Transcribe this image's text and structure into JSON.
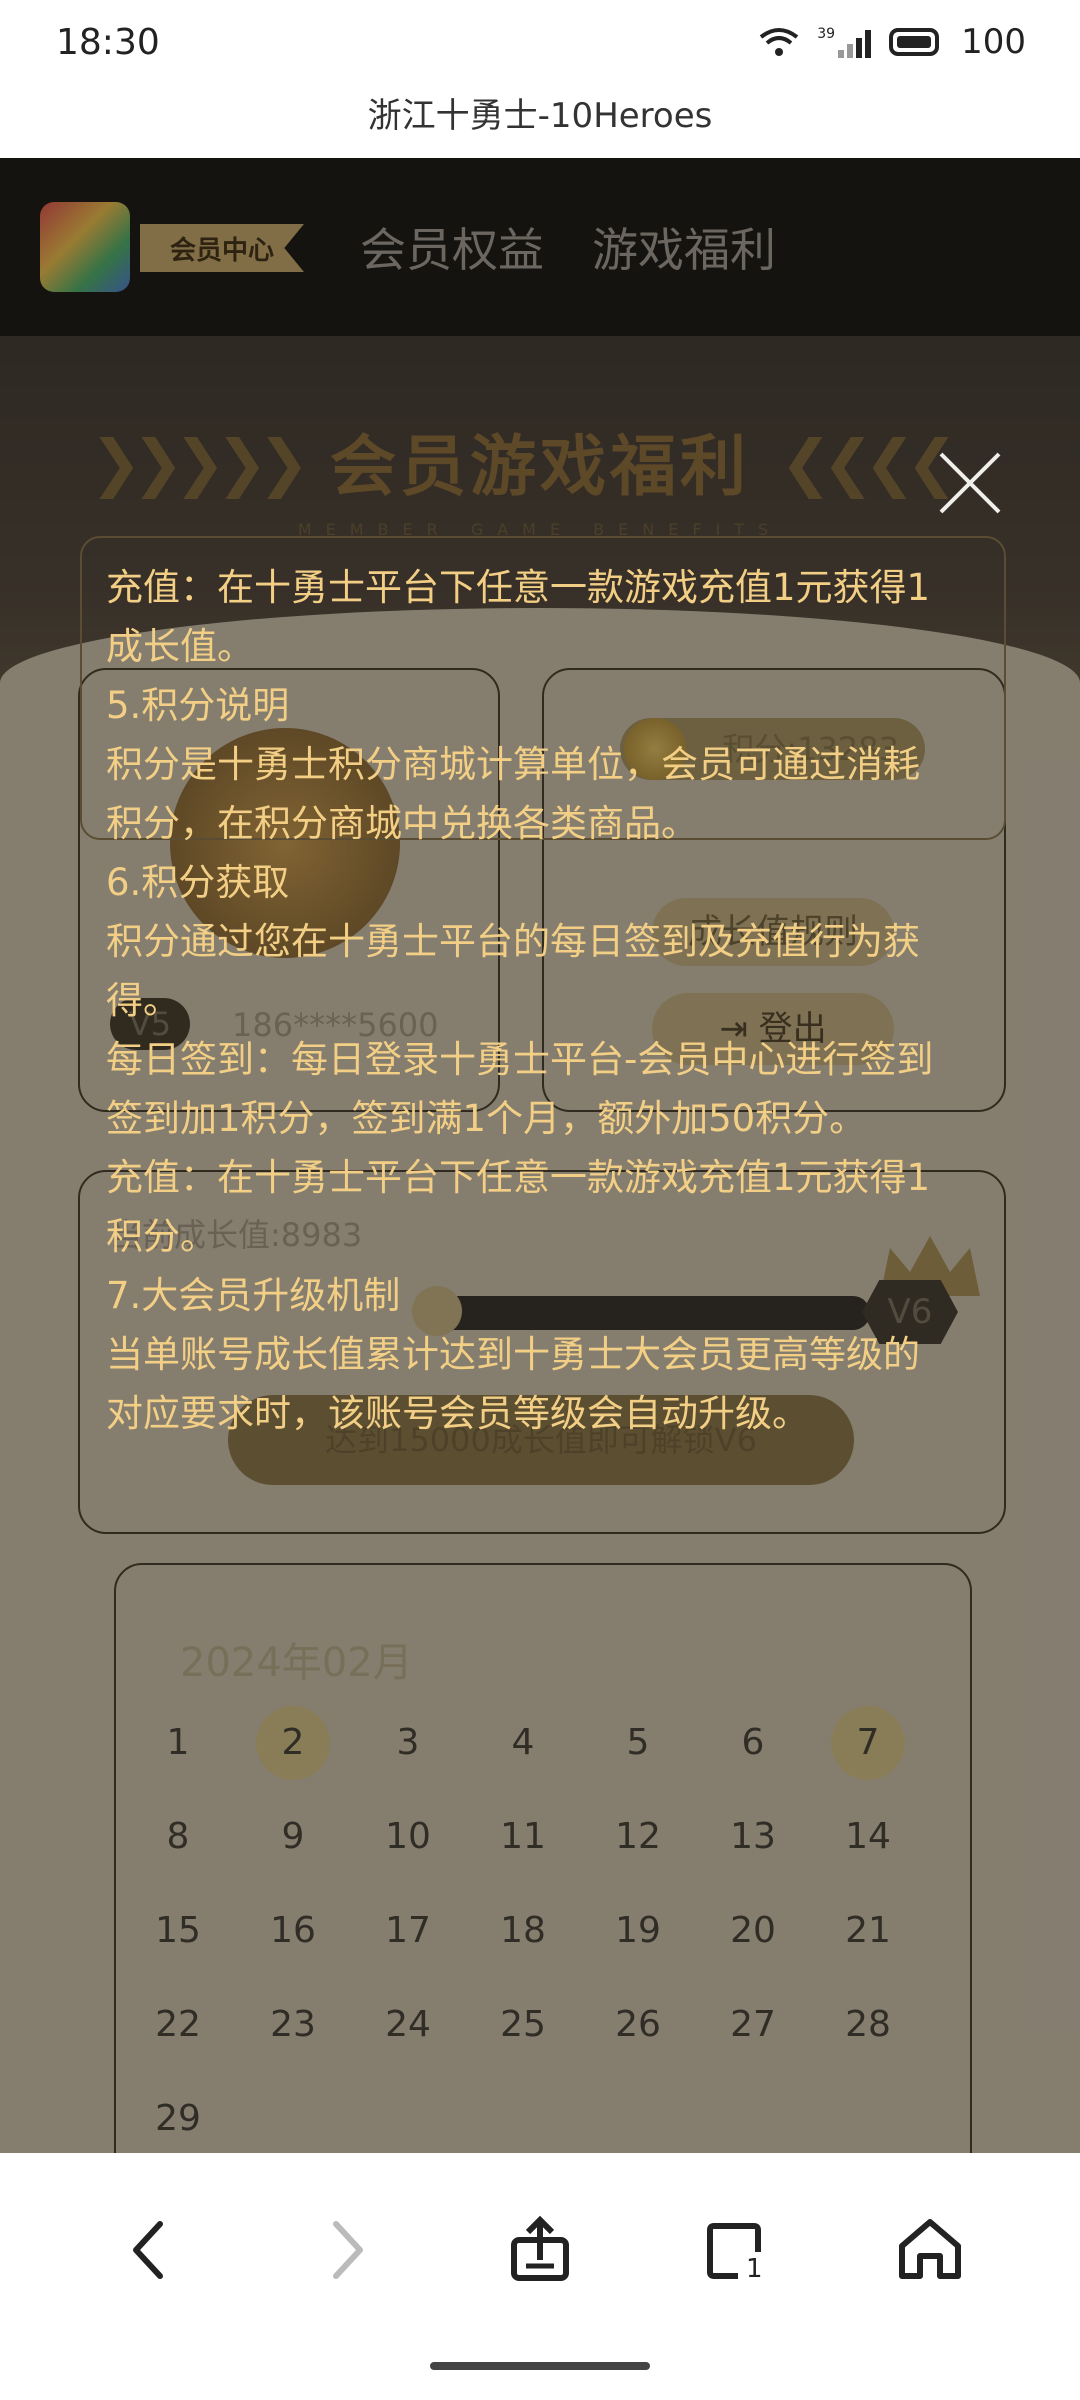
{
  "status_bar": {
    "time": "18:30",
    "signal_label": "39",
    "battery": "100"
  },
  "browser": {
    "page_title": "浙江十勇士-10Heroes"
  },
  "site_nav": {
    "vip_center": "会员中心",
    "items": [
      "会员权益",
      "游戏福利"
    ]
  },
  "banner": {
    "title": "会员游戏福利",
    "subtitle": "MEMBER GAME BENEFITS"
  },
  "profile": {
    "level": "V5",
    "phone": "186****5600",
    "points": "积分:13283",
    "growth_rules_button": "成长值规则",
    "logout_button": "登出"
  },
  "growth": {
    "current": "当前成长值:8983",
    "next_level": "V6",
    "progress_fraction": 0.0,
    "unlock_text": "达到15000成长值即可解锁V6"
  },
  "calendar": {
    "month": "2024年02月",
    "days": [
      "1",
      "2",
      "3",
      "4",
      "5",
      "6",
      "7",
      "8",
      "9",
      "10",
      "11",
      "12",
      "13",
      "14",
      "15",
      "16",
      "17",
      "18",
      "19",
      "20",
      "21",
      "22",
      "23",
      "24",
      "25",
      "26",
      "27",
      "28",
      "29"
    ],
    "highlighted": [
      "2",
      "7"
    ]
  },
  "rules_overlay": {
    "lines": [
      "充值：在十勇士平台下任意一款游戏充值1元获得1",
      "成长值。",
      "5.积分说明",
      "积分是十勇士积分商城计算单位，会员可通过消耗",
      "积分，在积分商城中兑换各类商品。",
      "6.积分获取",
      "积分通过您在十勇士平台的每日签到及充值行为获",
      "得。",
      "每日签到：每日登录十勇士平台-会员中心进行签到",
      "签到加1积分，签到满1个月，额外加50积分。",
      "充值：在十勇士平台下任意一款游戏充值1元获得1",
      "积分。",
      "7.大会员升级机制",
      "当单账号成长值累计达到十勇士大会员更高等级的",
      "对应要求时，该账号会员等级会自动升级。"
    ]
  },
  "colors": {
    "accent_gold": "#f3cf86",
    "nav_bg": "#0e0e0e"
  },
  "bottom_nav": {
    "icons": [
      "back-icon",
      "forward-icon",
      "share-icon",
      "tabs-icon",
      "home-icon"
    ],
    "tab_count": "1"
  }
}
